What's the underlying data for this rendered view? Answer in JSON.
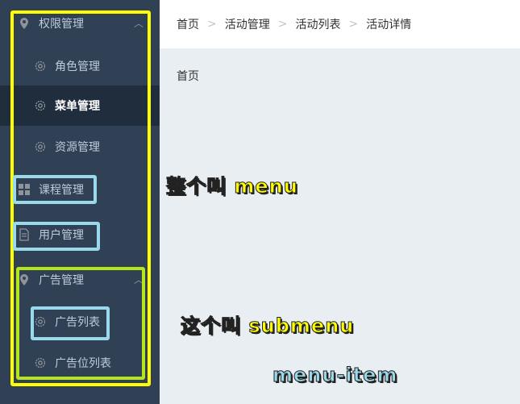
{
  "sidebar": {
    "items": [
      {
        "label": "权限管理",
        "icon": "location-icon"
      },
      {
        "label": "角色管理",
        "icon": "gear-icon"
      },
      {
        "label": "菜单管理",
        "icon": "gear-icon"
      },
      {
        "label": "资源管理",
        "icon": "gear-icon"
      },
      {
        "label": "课程管理",
        "icon": "grid-icon"
      },
      {
        "label": "用户管理",
        "icon": "document-icon"
      },
      {
        "label": "广告管理",
        "icon": "location-icon"
      },
      {
        "label": "广告列表",
        "icon": "gear-icon"
      },
      {
        "label": "广告位列表",
        "icon": "gear-icon"
      }
    ]
  },
  "breadcrumb": [
    "首页",
    "活动管理",
    "活动列表",
    "活动详情"
  ],
  "main": {
    "title": "首页"
  },
  "annotations": {
    "menu": "整个叫 menu",
    "submenu": "这个叫 submenu",
    "menu_item": "menu-item"
  },
  "colors": {
    "sidebar_bg": "#304156",
    "sidebar_active_bg": "#1f2d3d",
    "annotation_yellow": "#ffff00",
    "annotation_green": "#b5e61d",
    "annotation_blue": "#99d9ea"
  }
}
